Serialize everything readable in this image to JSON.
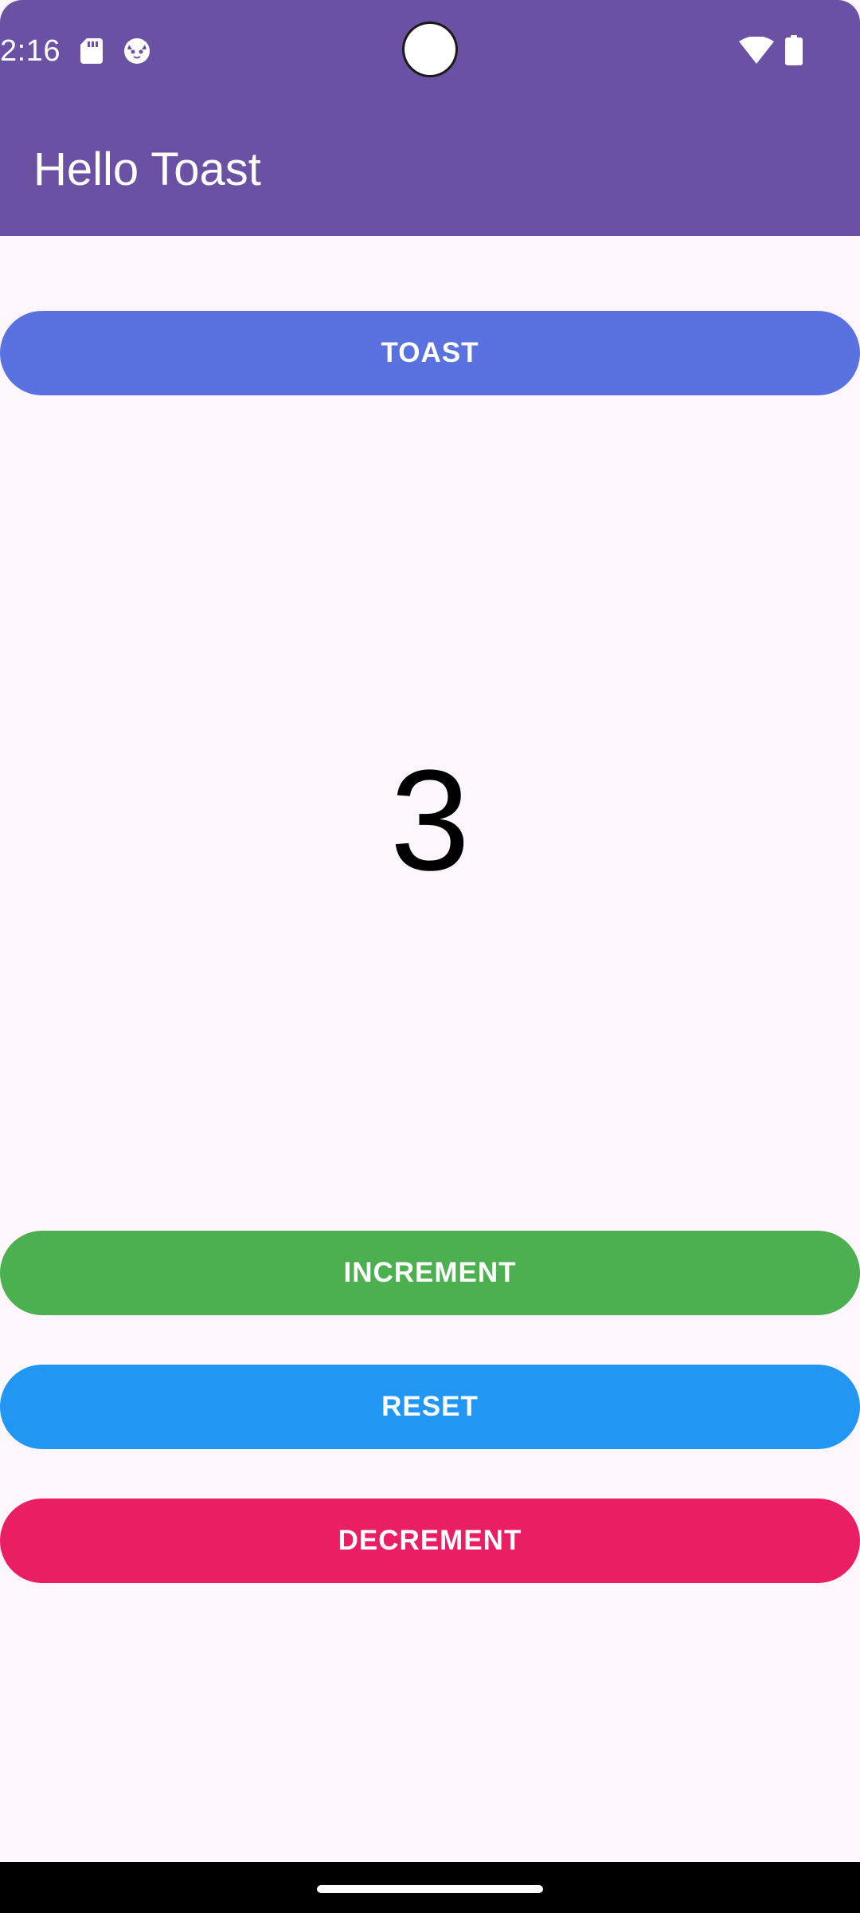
{
  "status_bar": {
    "time": "2:16",
    "icons": [
      "sd-card-icon",
      "cat-face-icon",
      "wifi-icon",
      "battery-icon"
    ],
    "background_color": "#6a51a3"
  },
  "app_bar": {
    "title": "Hello Toast",
    "background_color": "#6a51a3"
  },
  "main": {
    "toast_button_label": "TOAST",
    "count": "3",
    "increment_button_label": "INCREMENT",
    "reset_button_label": "RESET",
    "decrement_button_label": "DECREMENT"
  },
  "colors": {
    "toast": "#5a71e0",
    "increment": "#4caf50",
    "reset": "#2196f3",
    "decrement": "#e91e63",
    "page_background": "#fdf7fc"
  }
}
